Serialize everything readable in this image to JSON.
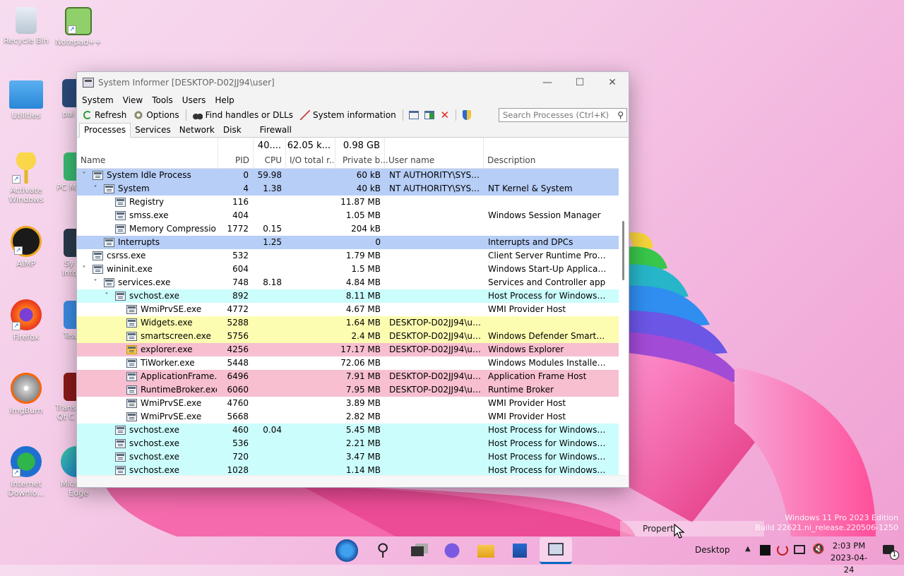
{
  "desktop": {
    "icons": [
      {
        "label": "Recycle Bin",
        "icon": "recycle-bin-icon"
      },
      {
        "label": "Notepad++",
        "icon": "notepadpp-icon"
      },
      {
        "label": "Utilities",
        "icon": "folder-icon"
      },
      {
        "label": "pai",
        "icon": "app-icon"
      },
      {
        "label": "Activate Windows",
        "icon": "key-icon"
      },
      {
        "label": "PC M",
        "icon": "app-icon"
      },
      {
        "label": "AIMP",
        "icon": "aimp-icon"
      },
      {
        "label": "Sy Info",
        "icon": "gear-icon"
      },
      {
        "label": "Firefox",
        "icon": "firefox-icon"
      },
      {
        "label": "Tea",
        "icon": "app-icon"
      },
      {
        "label": "ImgBurn",
        "icon": "imgburn-icon"
      },
      {
        "label": "Trans Qt C",
        "icon": "app-icon"
      },
      {
        "label": "Internet Downlo...",
        "icon": "idm-icon"
      },
      {
        "label": "Microsoft Edge",
        "icon": "edge-icon"
      }
    ]
  },
  "window": {
    "title": "System Informer [DESKTOP-D02JJ94\\user]",
    "controls": {
      "minimize": "—",
      "maximize": "☐",
      "close": "✕"
    },
    "menu": [
      "System",
      "View",
      "Tools",
      "Users",
      "Help"
    ],
    "toolbar": {
      "refresh": "Refresh",
      "options": "Options",
      "find": "Find handles or DLLs",
      "sysinfo": "System information"
    },
    "search_placeholder": "Search Processes (Ctrl+K)",
    "tabs": [
      "Processes",
      "Services",
      "Network",
      "Disk",
      "Firewall"
    ],
    "columns": {
      "name": "Name",
      "pid": "PID",
      "cpu": "CPU",
      "io": "I/O total r...",
      "private": "Private b...",
      "user": "User name",
      "desc": "Description"
    },
    "totals": {
      "cpu": "40....",
      "io": "62.05 k...",
      "private": "0.98 GB"
    },
    "colors": {
      "system": "#b7cef7",
      "service": "#ccfdfd",
      "own": "#fdfdb2",
      "immersive": "#f7bfd0",
      "accent": "#0067c0"
    },
    "rows": [
      {
        "name": "System Idle Process",
        "level": 0,
        "expand": "v",
        "pid": "0",
        "cpu": "59.98",
        "io": "",
        "priv": "60 kB",
        "user": "NT AUTHORITY\\SYSTEM",
        "desc": "",
        "hl": "system",
        "icon": "window"
      },
      {
        "name": "System",
        "level": 1,
        "expand": "v",
        "pid": "4",
        "cpu": "1.38",
        "io": "",
        "priv": "40 kB",
        "user": "NT AUTHORITY\\SYSTEM",
        "desc": "NT Kernel & System",
        "hl": "system",
        "icon": "window"
      },
      {
        "name": "Registry",
        "level": 2,
        "expand": "",
        "pid": "116",
        "cpu": "",
        "io": "",
        "priv": "11.87 MB",
        "user": "",
        "desc": "",
        "hl": "",
        "icon": "window"
      },
      {
        "name": "smss.exe",
        "level": 2,
        "expand": "",
        "pid": "404",
        "cpu": "",
        "io": "",
        "priv": "1.05 MB",
        "user": "",
        "desc": "Windows Session Manager",
        "hl": "",
        "icon": "window"
      },
      {
        "name": "Memory Compression",
        "level": 2,
        "expand": "",
        "pid": "1772",
        "cpu": "0.15",
        "io": "",
        "priv": "204 kB",
        "user": "",
        "desc": "",
        "hl": "",
        "icon": "window"
      },
      {
        "name": "Interrupts",
        "level": 1,
        "expand": "",
        "pid": "",
        "cpu": "1.25",
        "io": "",
        "priv": "0",
        "user": "",
        "desc": "Interrupts and DPCs",
        "hl": "system",
        "icon": "window"
      },
      {
        "name": "csrss.exe",
        "level": 0,
        "expand": "",
        "pid": "532",
        "cpu": "",
        "io": "",
        "priv": "1.79 MB",
        "user": "",
        "desc": "Client Server Runtime Process",
        "hl": "",
        "icon": "window"
      },
      {
        "name": "wininit.exe",
        "level": 0,
        "expand": "v",
        "pid": "604",
        "cpu": "",
        "io": "",
        "priv": "1.5 MB",
        "user": "",
        "desc": "Windows Start-Up Application",
        "hl": "",
        "icon": "window"
      },
      {
        "name": "services.exe",
        "level": 1,
        "expand": "v",
        "pid": "748",
        "cpu": "8.18",
        "io": "",
        "priv": "4.84 MB",
        "user": "",
        "desc": "Services and Controller app",
        "hl": "",
        "icon": "window"
      },
      {
        "name": "svchost.exe",
        "level": 2,
        "expand": "v",
        "pid": "892",
        "cpu": "",
        "io": "",
        "priv": "8.11 MB",
        "user": "",
        "desc": "Host Process for Windows Ser...",
        "hl": "service",
        "icon": "window"
      },
      {
        "name": "WmiPrvSE.exe",
        "level": 3,
        "expand": "",
        "pid": "4772",
        "cpu": "",
        "io": "",
        "priv": "4.67 MB",
        "user": "",
        "desc": "WMI Provider Host",
        "hl": "",
        "icon": "gear"
      },
      {
        "name": "Widgets.exe",
        "level": 3,
        "expand": "",
        "pid": "5288",
        "cpu": "",
        "io": "",
        "priv": "1.64 MB",
        "user": "DESKTOP-D02JJ94\\user",
        "desc": "",
        "hl": "own",
        "icon": "window"
      },
      {
        "name": "smartscreen.exe",
        "level": 3,
        "expand": "",
        "pid": "5756",
        "cpu": "",
        "io": "",
        "priv": "2.4 MB",
        "user": "DESKTOP-D02JJ94\\user",
        "desc": "Windows Defender SmartScreen",
        "hl": "own",
        "icon": "window"
      },
      {
        "name": "explorer.exe",
        "level": 3,
        "expand": "",
        "pid": "4256",
        "cpu": "",
        "io": "",
        "priv": "17.17 MB",
        "user": "DESKTOP-D02JJ94\\user",
        "desc": "Windows Explorer",
        "hl": "immersive",
        "icon": "folder"
      },
      {
        "name": "TiWorker.exe",
        "level": 3,
        "expand": "",
        "pid": "5448",
        "cpu": "",
        "io": "",
        "priv": "72.06 MB",
        "user": "",
        "desc": "Windows Modules Installer W...",
        "hl": "",
        "icon": "window"
      },
      {
        "name": "ApplicationFrame...",
        "level": 3,
        "expand": "",
        "pid": "6496",
        "cpu": "",
        "io": "",
        "priv": "7.91 MB",
        "user": "DESKTOP-D02JJ94\\user",
        "desc": "Application Frame Host",
        "hl": "immersive",
        "icon": "window"
      },
      {
        "name": "RuntimeBroker.exe",
        "level": 3,
        "expand": "",
        "pid": "6060",
        "cpu": "",
        "io": "",
        "priv": "7.95 MB",
        "user": "DESKTOP-D02JJ94\\user",
        "desc": "Runtime Broker",
        "hl": "immersive",
        "icon": "window"
      },
      {
        "name": "WmiPrvSE.exe",
        "level": 3,
        "expand": "",
        "pid": "4760",
        "cpu": "",
        "io": "",
        "priv": "3.89 MB",
        "user": "",
        "desc": "WMI Provider Host",
        "hl": "",
        "icon": "gear"
      },
      {
        "name": "WmiPrvSE.exe",
        "level": 3,
        "expand": "",
        "pid": "5668",
        "cpu": "",
        "io": "",
        "priv": "2.82 MB",
        "user": "",
        "desc": "WMI Provider Host",
        "hl": "",
        "icon": "gear"
      },
      {
        "name": "svchost.exe",
        "level": 2,
        "expand": "",
        "pid": "460",
        "cpu": "0.04",
        "io": "",
        "priv": "5.45 MB",
        "user": "",
        "desc": "Host Process for Windows Ser...",
        "hl": "service",
        "icon": "window"
      },
      {
        "name": "svchost.exe",
        "level": 2,
        "expand": "",
        "pid": "536",
        "cpu": "",
        "io": "",
        "priv": "2.21 MB",
        "user": "",
        "desc": "Host Process for Windows Ser...",
        "hl": "service",
        "icon": "window"
      },
      {
        "name": "svchost.exe",
        "level": 2,
        "expand": "",
        "pid": "720",
        "cpu": "",
        "io": "",
        "priv": "3.47 MB",
        "user": "",
        "desc": "Host Process for Windows Ser...",
        "hl": "service",
        "icon": "window"
      },
      {
        "name": "svchost.exe",
        "level": 2,
        "expand": "",
        "pid": "1028",
        "cpu": "",
        "io": "",
        "priv": "1.14 MB",
        "user": "",
        "desc": "Host Process for Windows Ser...",
        "hl": "service",
        "icon": "window"
      }
    ]
  },
  "taskbar": {
    "desktop_label": "Desktop",
    "time": "2:03 PM",
    "date": "2023-04-24",
    "notification_count": "1",
    "icons": [
      "start-icon",
      "search-icon",
      "task-view-icon",
      "teams-icon",
      "file-explorer-icon",
      "store-icon",
      "system-informer-icon"
    ]
  },
  "overlay": {
    "properties_label": "Properti",
    "watermark_line1": "Windows 11 Pro 2023 Edition",
    "watermark_line2": "Build 22621.ni_release.220506-1250"
  }
}
